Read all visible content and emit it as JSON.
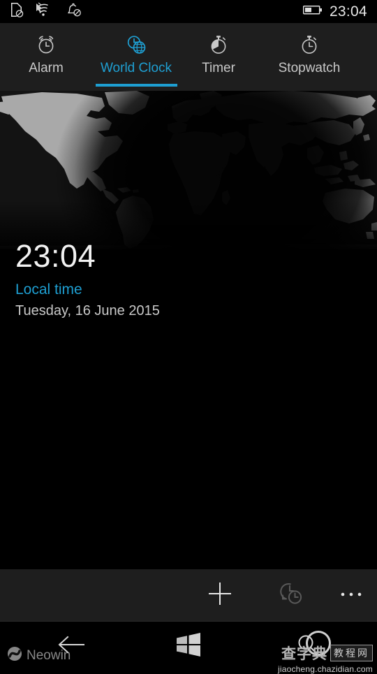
{
  "status_bar": {
    "icons": [
      {
        "name": "sim-card-off-icon",
        "label": "no SIM"
      },
      {
        "name": "wifi-off-icon",
        "label": "wifi unavailable"
      },
      {
        "name": "notifications-off-icon",
        "label": "quiet hours"
      }
    ],
    "battery": {
      "name": "battery-icon",
      "level_percent": 50
    },
    "time": "23:04"
  },
  "pivot": {
    "tabs": [
      {
        "label": "Alarm",
        "icon": "alarm-clock-icon",
        "active": false
      },
      {
        "label": "World Clock",
        "icon": "world-clock-icon",
        "active": true
      },
      {
        "label": "Timer",
        "icon": "timer-icon",
        "active": false
      },
      {
        "label": "Stopwatch",
        "icon": "stopwatch-icon",
        "active": false
      }
    ],
    "accent_color": "#1e9fd2",
    "inactive_color": "#c8c8c8"
  },
  "map": {
    "name": "world-day-night-map",
    "night_overlay": true,
    "land_color": "#a8a8a8",
    "ocean_color": "#1a1a1a"
  },
  "clocks": [
    {
      "time": "23:04",
      "label": "Local time",
      "date": "Tuesday, 16 June 2015"
    }
  ],
  "app_bar": {
    "buttons": [
      {
        "name": "add-clock-button",
        "icon": "plus-icon",
        "label": "add"
      },
      {
        "name": "compare-clocks-button",
        "icon": "compare-clocks-icon",
        "label": "compare",
        "disabled": true
      },
      {
        "name": "more-button",
        "icon": "ellipsis-icon",
        "label": "more"
      }
    ]
  },
  "nav_bar": {
    "buttons": [
      {
        "name": "back-button",
        "icon": "back-arrow-icon",
        "label": "back"
      },
      {
        "name": "start-button",
        "icon": "windows-logo-icon",
        "label": "start"
      },
      {
        "name": "search-button",
        "icon": "search-icon",
        "label": "search"
      }
    ]
  },
  "watermarks": {
    "neowin": "Neowin",
    "chinese_main": "查字典",
    "chinese_box": "教程网",
    "url": "jiaocheng.chazidian.com"
  }
}
